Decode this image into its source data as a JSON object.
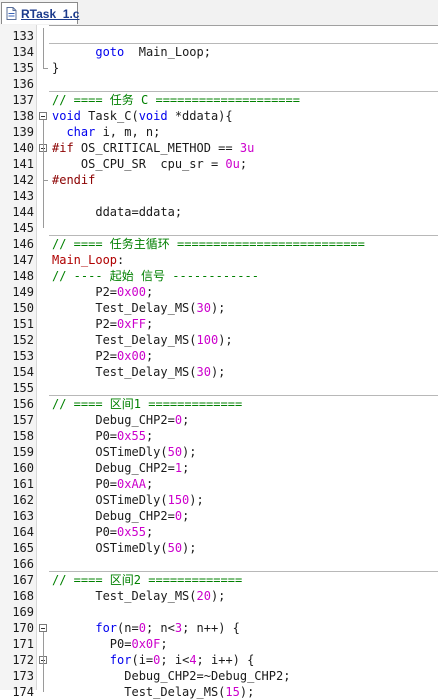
{
  "tab": {
    "label": "RTask_1.c",
    "icon": "c-file-icon"
  },
  "colors": {
    "keyword": "#0000ee",
    "number": "#cc00cc",
    "comment": "#008000",
    "preprocessor": "#8b0000",
    "label": "#b00000",
    "text": "#1a1a1a"
  },
  "lines": [
    {
      "num": "133",
      "tokens": []
    },
    {
      "num": "134",
      "tokens": [
        [
          "",
          "      "
        ],
        [
          "kw",
          "goto"
        ],
        [
          "",
          "  Main_Loop;"
        ]
      ]
    },
    {
      "num": "135",
      "tokens": [
        [
          "",
          "}"
        ]
      ]
    },
    {
      "num": "136",
      "tokens": []
    },
    {
      "num": "137",
      "tokens": [
        [
          "cm",
          "// ==== 任务 C ===================="
        ]
      ]
    },
    {
      "num": "138",
      "tokens": [
        [
          "kw",
          "void"
        ],
        [
          "",
          " Task_C("
        ],
        [
          "kw",
          "void"
        ],
        [
          "",
          " *ddata){"
        ]
      ]
    },
    {
      "num": "139",
      "tokens": [
        [
          "",
          "  "
        ],
        [
          "kw",
          "char"
        ],
        [
          "",
          " i, m, n;"
        ]
      ]
    },
    {
      "num": "140",
      "tokens": [
        [
          "pp",
          "#if"
        ],
        [
          "",
          " OS_CRITICAL_METHOD == "
        ],
        [
          "num",
          "3u"
        ]
      ]
    },
    {
      "num": "141",
      "tokens": [
        [
          "",
          "    OS_CPU_SR  cpu_sr = "
        ],
        [
          "num",
          "0u"
        ],
        [
          "",
          ";"
        ]
      ]
    },
    {
      "num": "142",
      "tokens": [
        [
          "pp",
          "#endif"
        ]
      ]
    },
    {
      "num": "143",
      "tokens": []
    },
    {
      "num": "144",
      "tokens": [
        [
          "",
          "      ddata=ddata;"
        ]
      ]
    },
    {
      "num": "145",
      "tokens": []
    },
    {
      "num": "146",
      "tokens": [
        [
          "cm",
          "// ==== 任务主循环 =========================="
        ]
      ]
    },
    {
      "num": "147",
      "tokens": [
        [
          "lbl",
          "Main_Loop"
        ],
        [
          "",
          ":"
        ]
      ]
    },
    {
      "num": "148",
      "tokens": [
        [
          "cm",
          "// ---- 起始 信号 ------------"
        ]
      ]
    },
    {
      "num": "149",
      "tokens": [
        [
          "",
          "      P2="
        ],
        [
          "num",
          "0x00"
        ],
        [
          "",
          ";"
        ]
      ]
    },
    {
      "num": "150",
      "tokens": [
        [
          "",
          "      Test_Delay_MS("
        ],
        [
          "num",
          "30"
        ],
        [
          "",
          ");"
        ]
      ]
    },
    {
      "num": "151",
      "tokens": [
        [
          "",
          "      P2="
        ],
        [
          "num",
          "0xFF"
        ],
        [
          "",
          ";"
        ]
      ]
    },
    {
      "num": "152",
      "tokens": [
        [
          "",
          "      Test_Delay_MS("
        ],
        [
          "num",
          "100"
        ],
        [
          "",
          ");"
        ]
      ]
    },
    {
      "num": "153",
      "tokens": [
        [
          "",
          "      P2="
        ],
        [
          "num",
          "0x00"
        ],
        [
          "",
          ";"
        ]
      ]
    },
    {
      "num": "154",
      "tokens": [
        [
          "",
          "      Test_Delay_MS("
        ],
        [
          "num",
          "30"
        ],
        [
          "",
          ");"
        ]
      ]
    },
    {
      "num": "155",
      "tokens": []
    },
    {
      "num": "156",
      "tokens": [
        [
          "cm",
          "// ==== 区间1 ============="
        ]
      ]
    },
    {
      "num": "157",
      "tokens": [
        [
          "",
          "      Debug_CHP2="
        ],
        [
          "num",
          "0"
        ],
        [
          "",
          ";"
        ]
      ]
    },
    {
      "num": "158",
      "tokens": [
        [
          "",
          "      P0="
        ],
        [
          "num",
          "0x55"
        ],
        [
          "",
          ";"
        ]
      ]
    },
    {
      "num": "159",
      "tokens": [
        [
          "",
          "      OSTimeDly("
        ],
        [
          "num",
          "50"
        ],
        [
          "",
          ");"
        ]
      ]
    },
    {
      "num": "160",
      "tokens": [
        [
          "",
          "      Debug_CHP2="
        ],
        [
          "num",
          "1"
        ],
        [
          "",
          ";"
        ]
      ]
    },
    {
      "num": "161",
      "tokens": [
        [
          "",
          "      P0="
        ],
        [
          "num",
          "0xAA"
        ],
        [
          "",
          ";"
        ]
      ]
    },
    {
      "num": "162",
      "tokens": [
        [
          "",
          "      OSTimeDly("
        ],
        [
          "num",
          "150"
        ],
        [
          "",
          ");"
        ]
      ]
    },
    {
      "num": "163",
      "tokens": [
        [
          "",
          "      Debug_CHP2="
        ],
        [
          "num",
          "0"
        ],
        [
          "",
          ";"
        ]
      ]
    },
    {
      "num": "164",
      "tokens": [
        [
          "",
          "      P0="
        ],
        [
          "num",
          "0x55"
        ],
        [
          "",
          ";"
        ]
      ]
    },
    {
      "num": "165",
      "tokens": [
        [
          "",
          "      OSTimeDly("
        ],
        [
          "num",
          "50"
        ],
        [
          "",
          ");"
        ]
      ]
    },
    {
      "num": "166",
      "tokens": []
    },
    {
      "num": "167",
      "tokens": [
        [
          "cm",
          "// ==== 区间2 ============="
        ]
      ]
    },
    {
      "num": "168",
      "tokens": [
        [
          "",
          "      Test_Delay_MS("
        ],
        [
          "num",
          "20"
        ],
        [
          "",
          ");"
        ]
      ]
    },
    {
      "num": "169",
      "tokens": []
    },
    {
      "num": "170",
      "tokens": [
        [
          "",
          "      "
        ],
        [
          "kw",
          "for"
        ],
        [
          "",
          "(n="
        ],
        [
          "num",
          "0"
        ],
        [
          "",
          "; n<"
        ],
        [
          "num",
          "3"
        ],
        [
          "",
          "; n++) {"
        ]
      ]
    },
    {
      "num": "171",
      "tokens": [
        [
          "",
          "        P0="
        ],
        [
          "num",
          "0x0F"
        ],
        [
          "",
          ";"
        ]
      ]
    },
    {
      "num": "172",
      "tokens": [
        [
          "",
          "        "
        ],
        [
          "kw",
          "for"
        ],
        [
          "",
          "(i="
        ],
        [
          "num",
          "0"
        ],
        [
          "",
          "; i<"
        ],
        [
          "num",
          "4"
        ],
        [
          "",
          "; i++) {"
        ]
      ]
    },
    {
      "num": "173",
      "tokens": [
        [
          "",
          "          Debug_CHP2=~Debug_CHP2;"
        ]
      ]
    },
    {
      "num": "174",
      "tokens": [
        [
          "",
          "          Test_Delay_MS("
        ],
        [
          "num",
          "15"
        ],
        [
          "",
          ");"
        ]
      ]
    }
  ]
}
